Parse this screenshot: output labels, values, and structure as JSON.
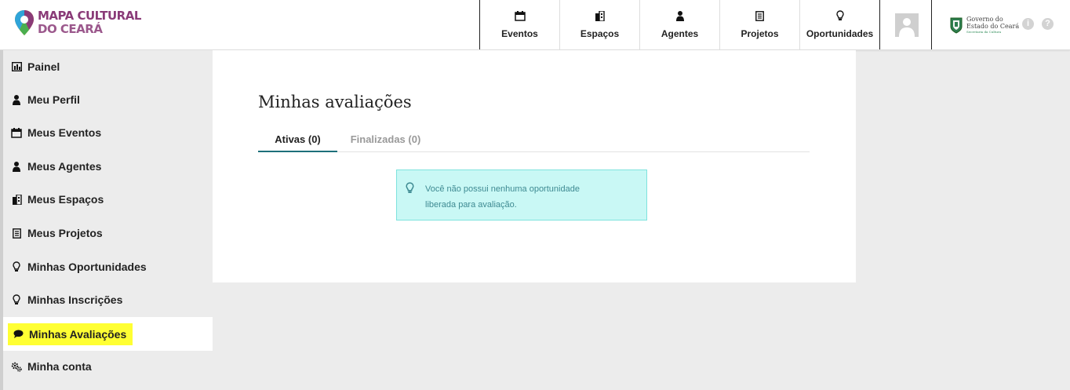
{
  "header": {
    "logo_line1": "MAPA CULTURAL",
    "logo_line2": "DO CEARÁ",
    "nav": [
      {
        "label": "Eventos",
        "icon": "calendar-icon"
      },
      {
        "label": "Espaços",
        "icon": "building-icon"
      },
      {
        "label": "Agentes",
        "icon": "person-icon"
      },
      {
        "label": "Projetos",
        "icon": "document-icon"
      },
      {
        "label": "Oportunidades",
        "icon": "lightbulb-icon"
      }
    ],
    "gov_line1": "Governo do",
    "gov_line2": "Estado do Ceará",
    "gov_line3": "Secretaria da Cultura",
    "info_symbol": "i",
    "help_symbol": "?"
  },
  "sidebar": {
    "items": [
      {
        "label": "Painel",
        "icon": "chart-icon"
      },
      {
        "label": "Meu Perfil",
        "icon": "person-icon"
      },
      {
        "label": "Meus Eventos",
        "icon": "calendar-icon"
      },
      {
        "label": "Meus Agentes",
        "icon": "person-icon"
      },
      {
        "label": "Meus Espaços",
        "icon": "building-icon"
      },
      {
        "label": "Meus Projetos",
        "icon": "document-icon"
      },
      {
        "label": "Minhas Oportunidades",
        "icon": "lightbulb-icon"
      },
      {
        "label": "Minhas Inscrições",
        "icon": "lightbulb-icon"
      },
      {
        "label": "Minhas Avaliações",
        "icon": "speech-bubble-icon"
      },
      {
        "label": "Minha conta",
        "icon": "gears-icon"
      }
    ]
  },
  "main": {
    "title": "Minhas avaliações",
    "tabs": [
      {
        "label": "Ativas (0)"
      },
      {
        "label": "Finalizadas (0)"
      }
    ],
    "alert_line1": "Você não possui nenhuma oportunidade",
    "alert_line2": "liberada para avaliação."
  },
  "colors": {
    "highlight": "#ffff33",
    "alert_bg": "#c9f8f5",
    "tab_underline": "#1d6f7a",
    "logo_purple": "#8a3b78"
  }
}
